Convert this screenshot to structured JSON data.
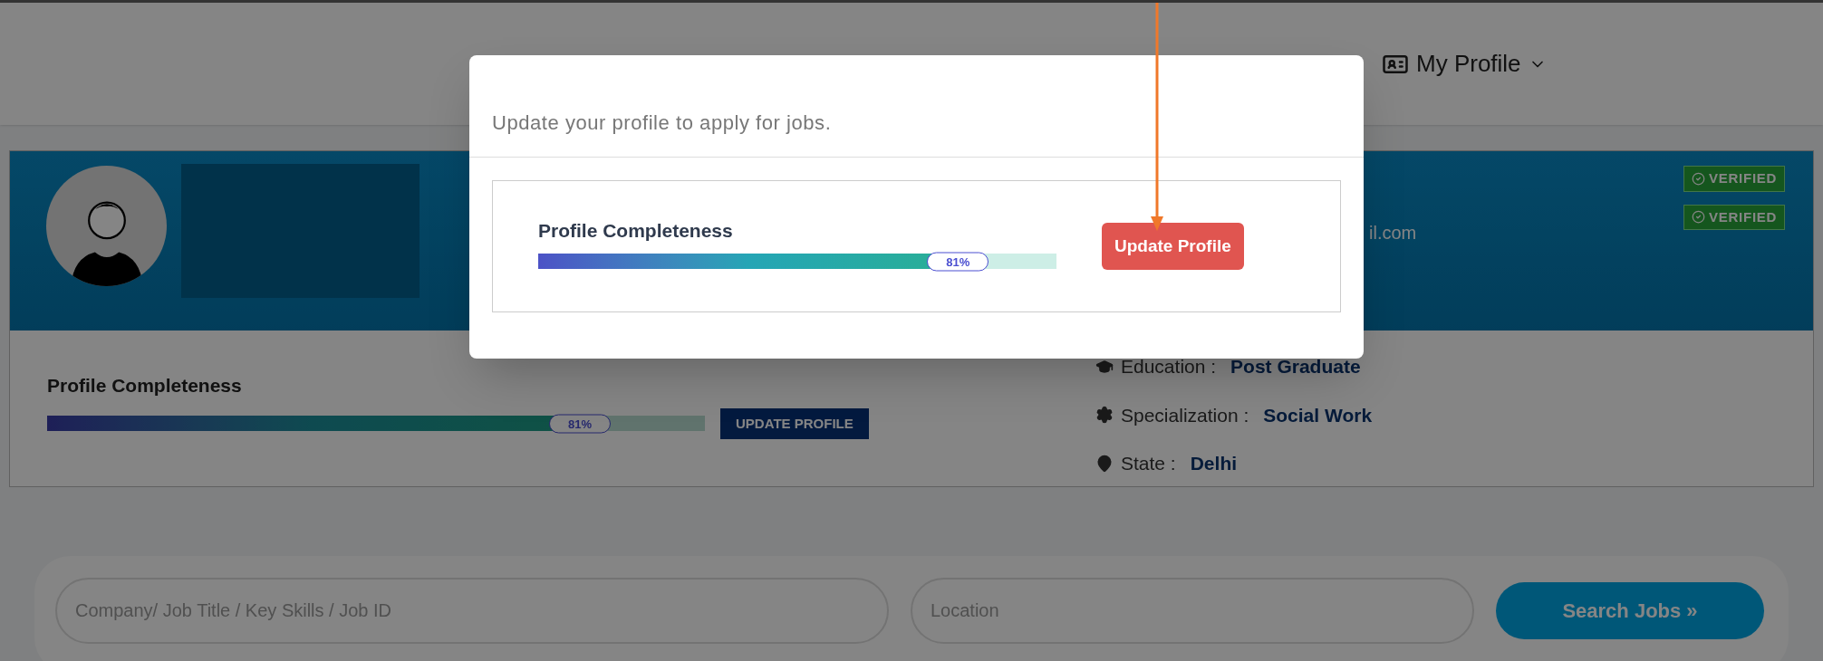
{
  "nav": {
    "profile_menu": {
      "label": "My Profile",
      "expanded": false
    }
  },
  "header": {
    "email_fragment": "il.com",
    "badges": [
      "VERIFIED",
      "VERIFIED"
    ]
  },
  "profile": {
    "completeness": {
      "title": "Profile Completeness",
      "level": 0.81,
      "reading": "81%"
    },
    "update_button": "UPDATE PROFILE",
    "details": [
      {
        "kind": "education",
        "label": "Education :",
        "value": "Post Graduate"
      },
      {
        "kind": "specialization",
        "label": "Specialization :",
        "value": "Social Work"
      },
      {
        "kind": "state",
        "label": "State :",
        "value": "Delhi"
      }
    ]
  },
  "search": {
    "keyword_placeholder": "Company/ Job Title / Key Skills / Job ID",
    "location_placeholder": "Location",
    "button": "Search Jobs »"
  },
  "modal": {
    "message": "Update your profile to apply for jobs.",
    "completeness": {
      "title": "Profile Completeness",
      "level": 0.81,
      "reading": "81%"
    },
    "button": "Update Profile"
  }
}
